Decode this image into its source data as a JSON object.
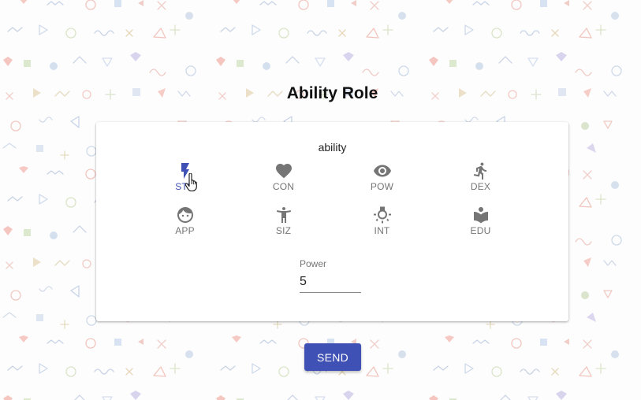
{
  "page": {
    "title": "Ability Role",
    "accent_color": "#3f51b5"
  },
  "ability": {
    "label": "ability",
    "selected": "STR",
    "items": [
      {
        "label": "STR",
        "icon": "lightning-icon"
      },
      {
        "label": "CON",
        "icon": "heart-icon"
      },
      {
        "label": "POW",
        "icon": "eye-icon"
      },
      {
        "label": "DEX",
        "icon": "running-person-icon"
      },
      {
        "label": "APP",
        "icon": "face-icon"
      },
      {
        "label": "SIZ",
        "icon": "person-standing-icon"
      },
      {
        "label": "INT",
        "icon": "lightbulb-icon"
      },
      {
        "label": "EDU",
        "icon": "book-icon"
      }
    ]
  },
  "power": {
    "label": "Power",
    "value": "5"
  },
  "send": {
    "label": "SEND"
  }
}
